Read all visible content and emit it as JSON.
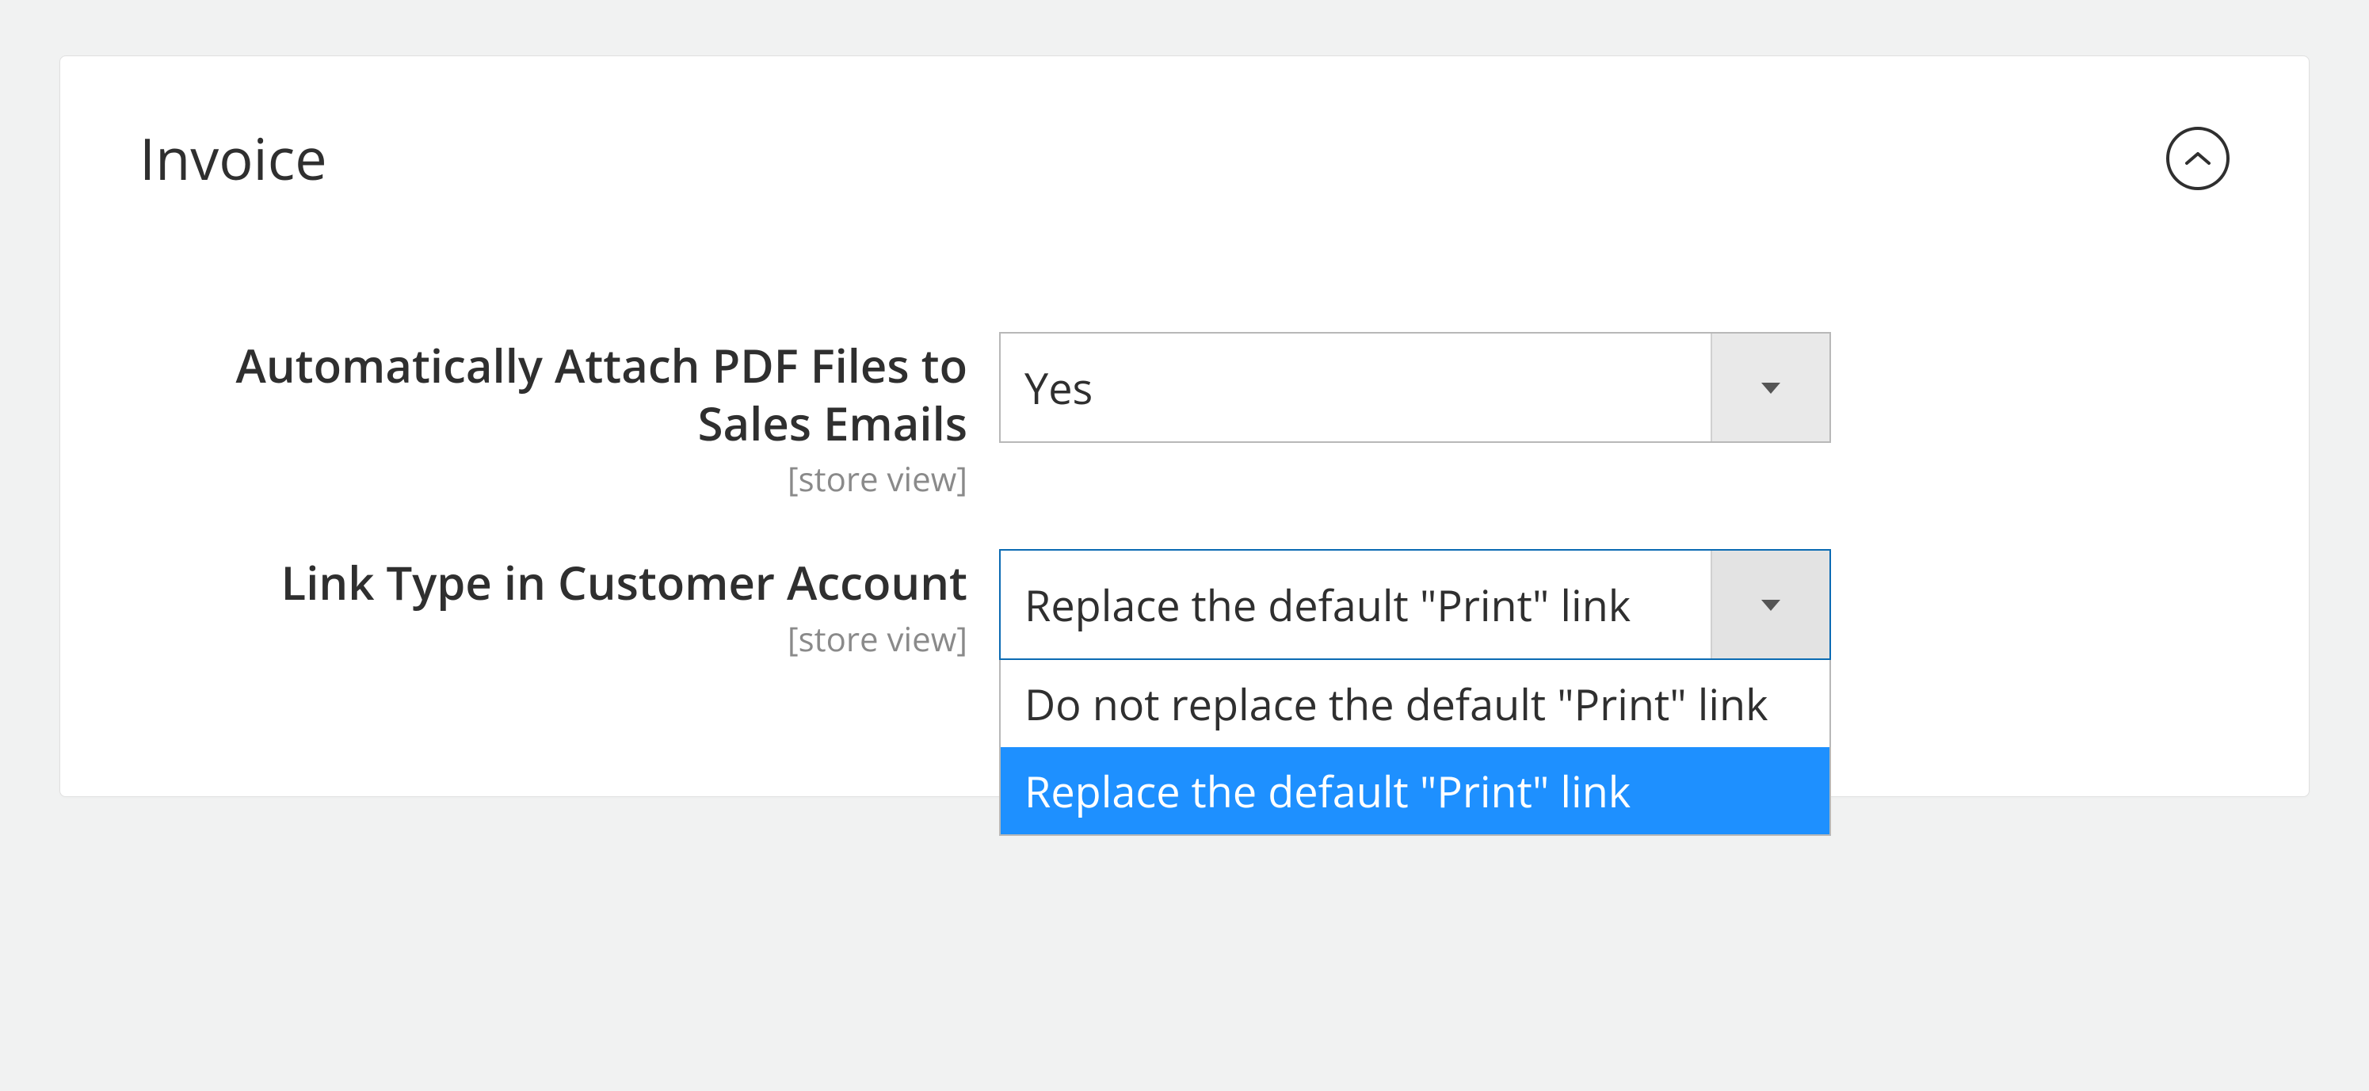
{
  "section": {
    "title": "Invoice"
  },
  "fields": {
    "attach_pdf": {
      "label": "Automatically Attach PDF Files to Sales Emails",
      "scope": "[store view]",
      "value": "Yes"
    },
    "link_type": {
      "label": "Link Type in Customer Account",
      "scope": "[store view]",
      "value": "Replace the default \"Print\" link",
      "options": [
        "Do not replace the default \"Print\" link",
        "Replace the default \"Print\" link"
      ]
    }
  }
}
